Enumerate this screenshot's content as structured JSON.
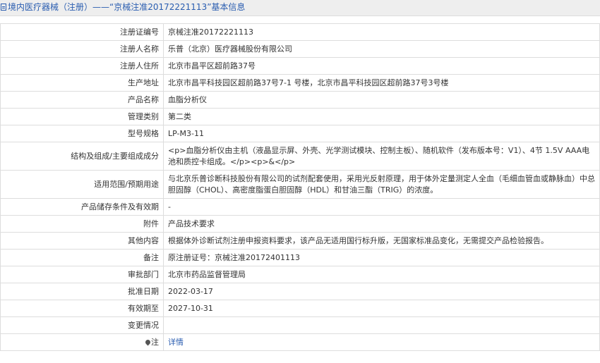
{
  "header": {
    "title": "境内医疗器械（注册）——“京械注准20172221113”基本信息"
  },
  "rows": [
    {
      "label": "注册证编号",
      "value": "京械注准20172221113"
    },
    {
      "label": "注册人名称",
      "value": "乐普（北京）医疗器械股份有限公司"
    },
    {
      "label": "注册人住所",
      "value": "北京市昌平区超前路37号"
    },
    {
      "label": "生产地址",
      "value": "北京市昌平科技园区超前路37号7-1 号楼，北京市昌平科技园区超前路37号3号楼"
    },
    {
      "label": "产品名称",
      "value": "血脂分析仪"
    },
    {
      "label": "管理类别",
      "value": "第二类"
    },
    {
      "label": "型号规格",
      "value": "LP-M3-11"
    },
    {
      "label": "结构及组成/主要组成成分",
      "value": "<p>血脂分析仪由主机（液晶显示屏、外壳、光学测试模块、控制主板）、随机软件（发布版本号：V1）、4节 1.5V AAA电池和质控卡组成。</p><p>&</p>"
    },
    {
      "label": "适用范围/预期用途",
      "value": "与北京乐普诊断科技股份有限公司的试剂配套使用，采用光反射原理，用于体外定量测定人全血（毛细血管血或静脉血）中总胆固醇（CHOL）、高密度脂蛋白胆固醇（HDL）和甘油三酯（TRIG）的浓度。"
    },
    {
      "label": "产品储存条件及有效期",
      "value": "-"
    },
    {
      "label": "附件",
      "value": "产品技术要求"
    },
    {
      "label": "其他内容",
      "value": "根据体外诊断试剂注册申报资料要求，该产品无适用国行标升版，无国家标准品变化，无需提交产品检验报告。"
    },
    {
      "label": "备注",
      "value": "原注册证号：京械注准20172401113"
    },
    {
      "label": "审批部门",
      "value": "北京市药品监督管理局"
    },
    {
      "label": "批准日期",
      "value": "2022-03-17"
    },
    {
      "label": "有效期至",
      "value": "2027-10-31"
    },
    {
      "label": "变更情况",
      "value": ""
    },
    {
      "label": "注",
      "value": "详情"
    }
  ],
  "colors": {
    "link": "#2a5db0",
    "border": "#dddddd",
    "header_bg": "#eeeeee"
  },
  "icons": {
    "title": "document-icon",
    "note": "map-pin-icon"
  }
}
